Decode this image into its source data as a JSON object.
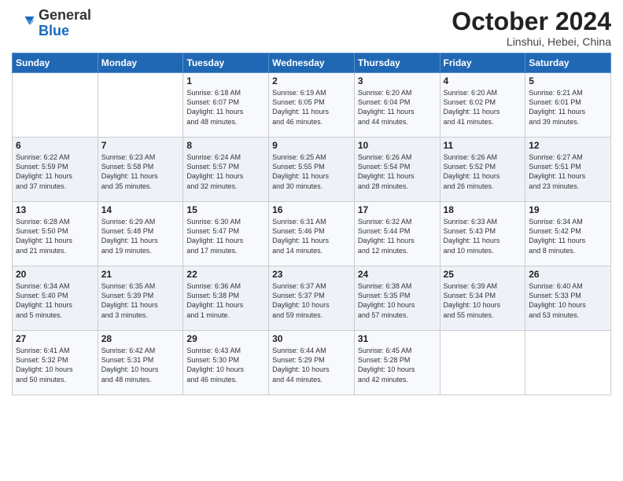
{
  "header": {
    "logo_general": "General",
    "logo_blue": "Blue",
    "month": "October 2024",
    "location": "Linshui, Hebei, China"
  },
  "weekdays": [
    "Sunday",
    "Monday",
    "Tuesday",
    "Wednesday",
    "Thursday",
    "Friday",
    "Saturday"
  ],
  "weeks": [
    [
      {
        "day": "",
        "info": ""
      },
      {
        "day": "",
        "info": ""
      },
      {
        "day": "1",
        "info": "Sunrise: 6:18 AM\nSunset: 6:07 PM\nDaylight: 11 hours\nand 48 minutes."
      },
      {
        "day": "2",
        "info": "Sunrise: 6:19 AM\nSunset: 6:05 PM\nDaylight: 11 hours\nand 46 minutes."
      },
      {
        "day": "3",
        "info": "Sunrise: 6:20 AM\nSunset: 6:04 PM\nDaylight: 11 hours\nand 44 minutes."
      },
      {
        "day": "4",
        "info": "Sunrise: 6:20 AM\nSunset: 6:02 PM\nDaylight: 11 hours\nand 41 minutes."
      },
      {
        "day": "5",
        "info": "Sunrise: 6:21 AM\nSunset: 6:01 PM\nDaylight: 11 hours\nand 39 minutes."
      }
    ],
    [
      {
        "day": "6",
        "info": "Sunrise: 6:22 AM\nSunset: 5:59 PM\nDaylight: 11 hours\nand 37 minutes."
      },
      {
        "day": "7",
        "info": "Sunrise: 6:23 AM\nSunset: 5:58 PM\nDaylight: 11 hours\nand 35 minutes."
      },
      {
        "day": "8",
        "info": "Sunrise: 6:24 AM\nSunset: 5:57 PM\nDaylight: 11 hours\nand 32 minutes."
      },
      {
        "day": "9",
        "info": "Sunrise: 6:25 AM\nSunset: 5:55 PM\nDaylight: 11 hours\nand 30 minutes."
      },
      {
        "day": "10",
        "info": "Sunrise: 6:26 AM\nSunset: 5:54 PM\nDaylight: 11 hours\nand 28 minutes."
      },
      {
        "day": "11",
        "info": "Sunrise: 6:26 AM\nSunset: 5:52 PM\nDaylight: 11 hours\nand 26 minutes."
      },
      {
        "day": "12",
        "info": "Sunrise: 6:27 AM\nSunset: 5:51 PM\nDaylight: 11 hours\nand 23 minutes."
      }
    ],
    [
      {
        "day": "13",
        "info": "Sunrise: 6:28 AM\nSunset: 5:50 PM\nDaylight: 11 hours\nand 21 minutes."
      },
      {
        "day": "14",
        "info": "Sunrise: 6:29 AM\nSunset: 5:48 PM\nDaylight: 11 hours\nand 19 minutes."
      },
      {
        "day": "15",
        "info": "Sunrise: 6:30 AM\nSunset: 5:47 PM\nDaylight: 11 hours\nand 17 minutes."
      },
      {
        "day": "16",
        "info": "Sunrise: 6:31 AM\nSunset: 5:46 PM\nDaylight: 11 hours\nand 14 minutes."
      },
      {
        "day": "17",
        "info": "Sunrise: 6:32 AM\nSunset: 5:44 PM\nDaylight: 11 hours\nand 12 minutes."
      },
      {
        "day": "18",
        "info": "Sunrise: 6:33 AM\nSunset: 5:43 PM\nDaylight: 11 hours\nand 10 minutes."
      },
      {
        "day": "19",
        "info": "Sunrise: 6:34 AM\nSunset: 5:42 PM\nDaylight: 11 hours\nand 8 minutes."
      }
    ],
    [
      {
        "day": "20",
        "info": "Sunrise: 6:34 AM\nSunset: 5:40 PM\nDaylight: 11 hours\nand 5 minutes."
      },
      {
        "day": "21",
        "info": "Sunrise: 6:35 AM\nSunset: 5:39 PM\nDaylight: 11 hours\nand 3 minutes."
      },
      {
        "day": "22",
        "info": "Sunrise: 6:36 AM\nSunset: 5:38 PM\nDaylight: 11 hours\nand 1 minute."
      },
      {
        "day": "23",
        "info": "Sunrise: 6:37 AM\nSunset: 5:37 PM\nDaylight: 10 hours\nand 59 minutes."
      },
      {
        "day": "24",
        "info": "Sunrise: 6:38 AM\nSunset: 5:35 PM\nDaylight: 10 hours\nand 57 minutes."
      },
      {
        "day": "25",
        "info": "Sunrise: 6:39 AM\nSunset: 5:34 PM\nDaylight: 10 hours\nand 55 minutes."
      },
      {
        "day": "26",
        "info": "Sunrise: 6:40 AM\nSunset: 5:33 PM\nDaylight: 10 hours\nand 53 minutes."
      }
    ],
    [
      {
        "day": "27",
        "info": "Sunrise: 6:41 AM\nSunset: 5:32 PM\nDaylight: 10 hours\nand 50 minutes."
      },
      {
        "day": "28",
        "info": "Sunrise: 6:42 AM\nSunset: 5:31 PM\nDaylight: 10 hours\nand 48 minutes."
      },
      {
        "day": "29",
        "info": "Sunrise: 6:43 AM\nSunset: 5:30 PM\nDaylight: 10 hours\nand 46 minutes."
      },
      {
        "day": "30",
        "info": "Sunrise: 6:44 AM\nSunset: 5:29 PM\nDaylight: 10 hours\nand 44 minutes."
      },
      {
        "day": "31",
        "info": "Sunrise: 6:45 AM\nSunset: 5:28 PM\nDaylight: 10 hours\nand 42 minutes."
      },
      {
        "day": "",
        "info": ""
      },
      {
        "day": "",
        "info": ""
      }
    ]
  ]
}
